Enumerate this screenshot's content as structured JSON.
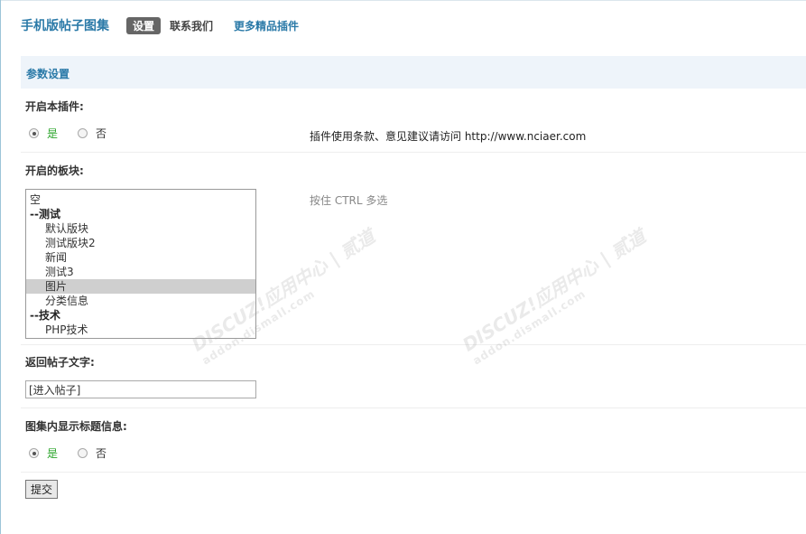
{
  "header": {
    "title": "手机版帖子图集",
    "tabs": [
      {
        "label": "设置",
        "active": true
      },
      {
        "label": "联系我们",
        "active": false
      },
      {
        "label": "更多精品插件",
        "active": false
      }
    ]
  },
  "section": {
    "title": "参数设置"
  },
  "fields": {
    "enable_plugin": {
      "label": "开启本插件:",
      "options": [
        "是",
        "否"
      ],
      "selected": "是",
      "tip": "插件使用条款、意见建议请访问 http://www.nciaer.com"
    },
    "forums": {
      "label": "开启的板块:",
      "tip": "按住 CTRL 多选",
      "options": [
        {
          "text": "空",
          "type": "option"
        },
        {
          "text": "--测试",
          "type": "group"
        },
        {
          "text": "默认版块",
          "type": "child"
        },
        {
          "text": "测试版块2",
          "type": "child"
        },
        {
          "text": "新闻",
          "type": "child"
        },
        {
          "text": "测试3",
          "type": "child"
        },
        {
          "text": "图片",
          "type": "child",
          "selected": true
        },
        {
          "text": "分类信息",
          "type": "child"
        },
        {
          "text": "--技术",
          "type": "group"
        },
        {
          "text": "PHP技术",
          "type": "child"
        }
      ]
    },
    "return_text": {
      "label": "返回帖子文字:",
      "value": "[进入帖子]"
    },
    "show_title": {
      "label": "图集内显示标题信息:",
      "options": [
        "是",
        "否"
      ],
      "selected": "是"
    }
  },
  "submit_label": "提交",
  "watermark": {
    "brand": "DISCUZ!应用中心 | 贰道",
    "url": "addon.dismall.com"
  },
  "colors": {
    "accent": "#2b7aa8",
    "yes_green": "#2aa52a",
    "section_bg": "#eef4fa"
  }
}
